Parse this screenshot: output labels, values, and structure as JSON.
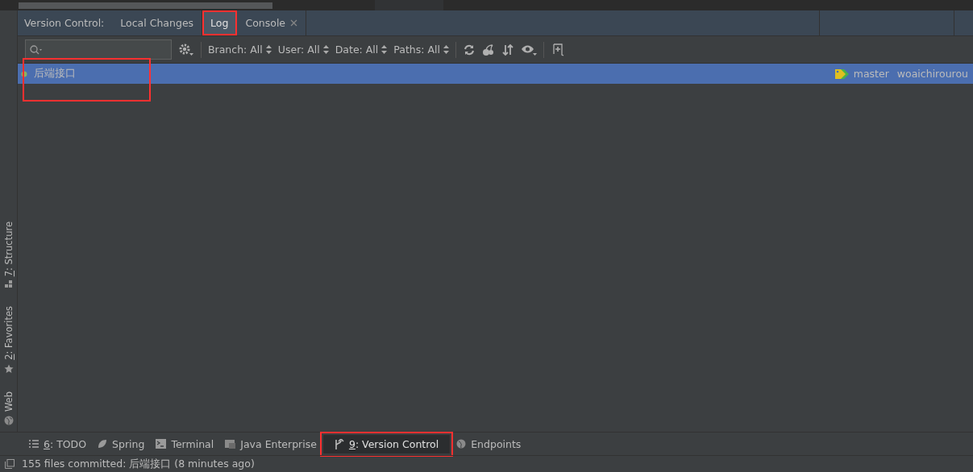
{
  "panel": {
    "title": "Version Control:",
    "tabs": [
      {
        "label": "Local Changes",
        "selected": false,
        "closable": false,
        "marked": false
      },
      {
        "label": "Log",
        "selected": true,
        "closable": false,
        "marked": true
      },
      {
        "label": "Console",
        "selected": false,
        "closable": true,
        "marked": false
      }
    ]
  },
  "toolbar": {
    "filters": [
      "Branch: All",
      "User: All",
      "Date: All",
      "Paths: All"
    ]
  },
  "commits": [
    {
      "subject": "后端接口",
      "selected": true,
      "marked": true,
      "branch": "master",
      "author": "woaichirourou"
    }
  ],
  "side_tools": [
    {
      "mnemonic": "7",
      "label": ": Structure",
      "kind": "structure"
    },
    {
      "mnemonic": "2",
      "label": ": Favorites",
      "kind": "favorites"
    },
    {
      "label": "Web",
      "kind": "web"
    }
  ],
  "bottom_tools": [
    {
      "mnemonic": "6",
      "label": ": TODO",
      "kind": "todo",
      "selected": false,
      "marked": false
    },
    {
      "label": "Spring",
      "kind": "spring",
      "selected": false,
      "marked": false
    },
    {
      "label": "Terminal",
      "kind": "terminal",
      "selected": false,
      "marked": false
    },
    {
      "label": "Java Enterprise",
      "kind": "java",
      "selected": false,
      "marked": false
    },
    {
      "mnemonic": "9",
      "label": ": Version Control",
      "kind": "vcs",
      "selected": true,
      "marked": true
    },
    {
      "label": "Endpoints",
      "kind": "web",
      "selected": false,
      "marked": false
    }
  ],
  "status_bar": {
    "message": "155 files committed: 后端接口 (8 minutes ago)"
  }
}
